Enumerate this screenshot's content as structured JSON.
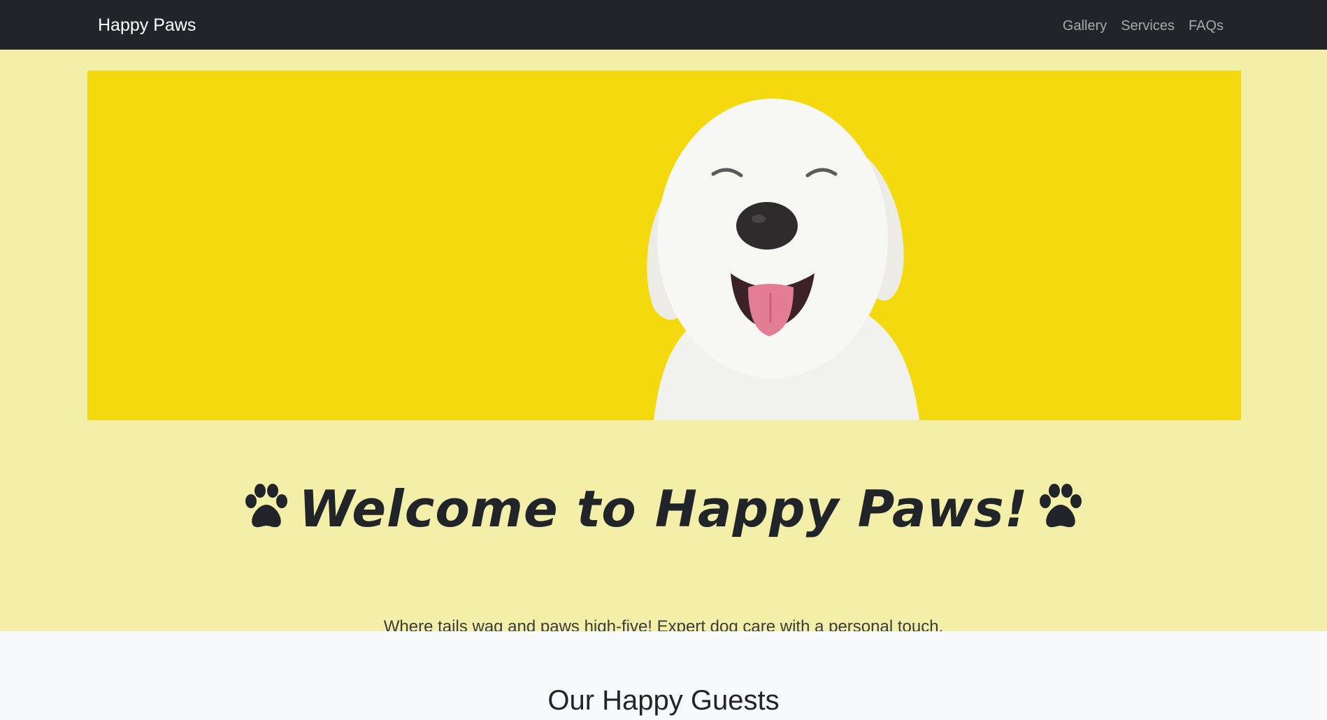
{
  "navbar": {
    "brand": "Happy Paws",
    "links": [
      "Gallery",
      "Services",
      "FAQs"
    ]
  },
  "hero": {
    "image": "smiling white dog on yellow background",
    "title": "Welcome to Happy Paws!",
    "icon": "paw-icon",
    "subtitle": "Where tails wag and paws high-five! Expert dog care with a personal touch."
  },
  "guests": {
    "title": "Our Happy Guests"
  },
  "colors": {
    "navbar": "#212529",
    "hero_bg": "#f4efa8",
    "image_bg": "#f3d90e",
    "section_bg": "#f8f9fa",
    "text": "#212529"
  }
}
